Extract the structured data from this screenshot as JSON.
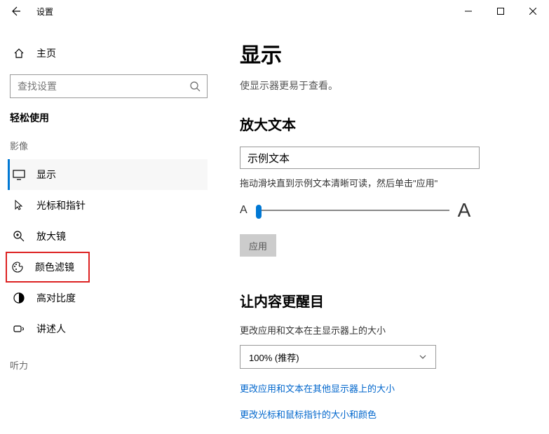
{
  "titlebar": {
    "title": "设置"
  },
  "sidebar": {
    "home": "主页",
    "search_placeholder": "查找设置",
    "section": "轻松使用",
    "group_visual": "影像",
    "group_hearing": "听力",
    "items": [
      {
        "label": "显示"
      },
      {
        "label": "光标和指针"
      },
      {
        "label": "放大镜"
      },
      {
        "label": "颜色滤镜"
      },
      {
        "label": "高对比度"
      },
      {
        "label": "讲述人"
      }
    ]
  },
  "main": {
    "title": "显示",
    "subtitle": "使显示器更易于查看。",
    "text_size": {
      "heading": "放大文本",
      "sample": "示例文本",
      "hint": "拖动滑块直到示例文本清晰可读，然后单击\"应用\"",
      "letter_small": "A",
      "letter_large": "A",
      "apply": "应用"
    },
    "everything_bigger": {
      "heading": "让内容更醒目",
      "scale_label": "更改应用和文本在主显示器上的大小",
      "scale_value": "100% (推荐)",
      "link_other": "更改应用和文本在其他显示器上的大小",
      "link_cursor": "更改光标和鼠标指针的大小和颜色"
    }
  }
}
